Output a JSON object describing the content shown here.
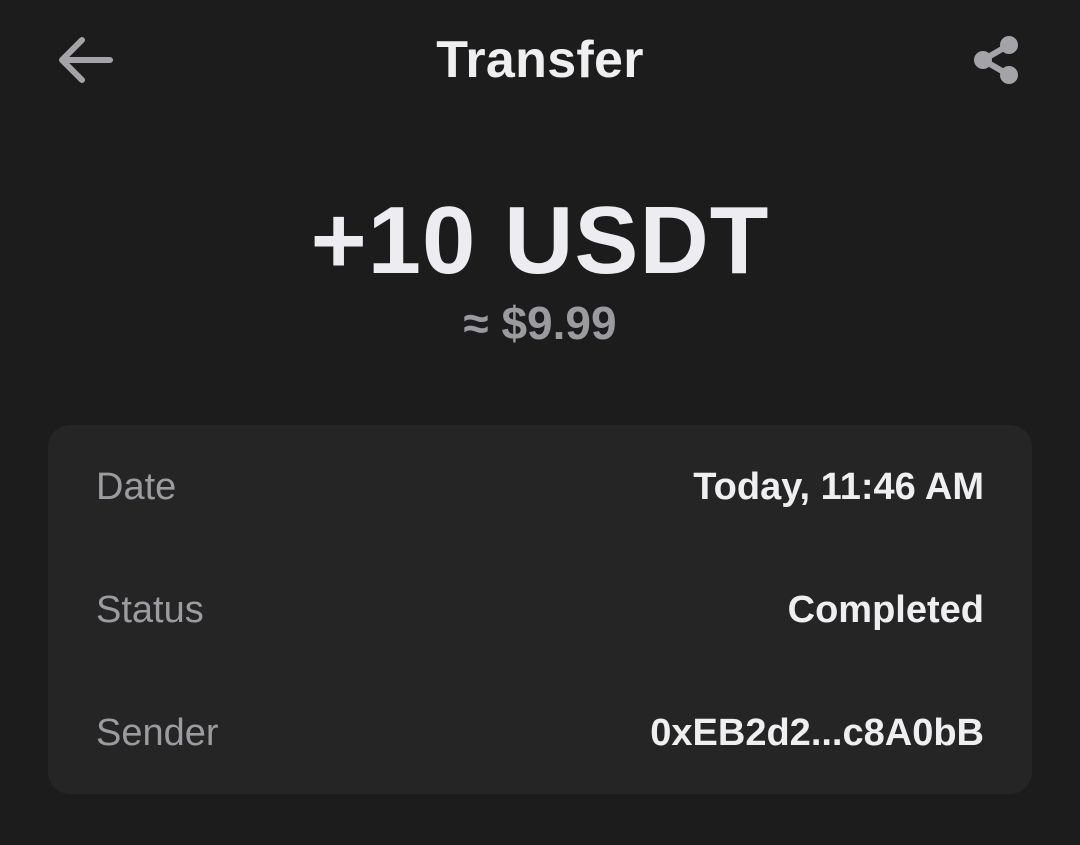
{
  "header": {
    "title": "Transfer",
    "back_icon": "arrow-left-icon",
    "share_icon": "share-icon"
  },
  "transaction": {
    "amount": "+10 USDT",
    "fiat_value": "≈ $9.99"
  },
  "details": [
    {
      "label": "Date",
      "value": "Today, 11:46 AM"
    },
    {
      "label": "Status",
      "value": "Completed"
    },
    {
      "label": "Sender",
      "value": "0xEB2d2...c8A0bB"
    }
  ],
  "colors": {
    "background": "#1c1c1d",
    "card": "#252526",
    "primary_text": "#efeff1",
    "secondary_text": "#9b9ba0"
  }
}
